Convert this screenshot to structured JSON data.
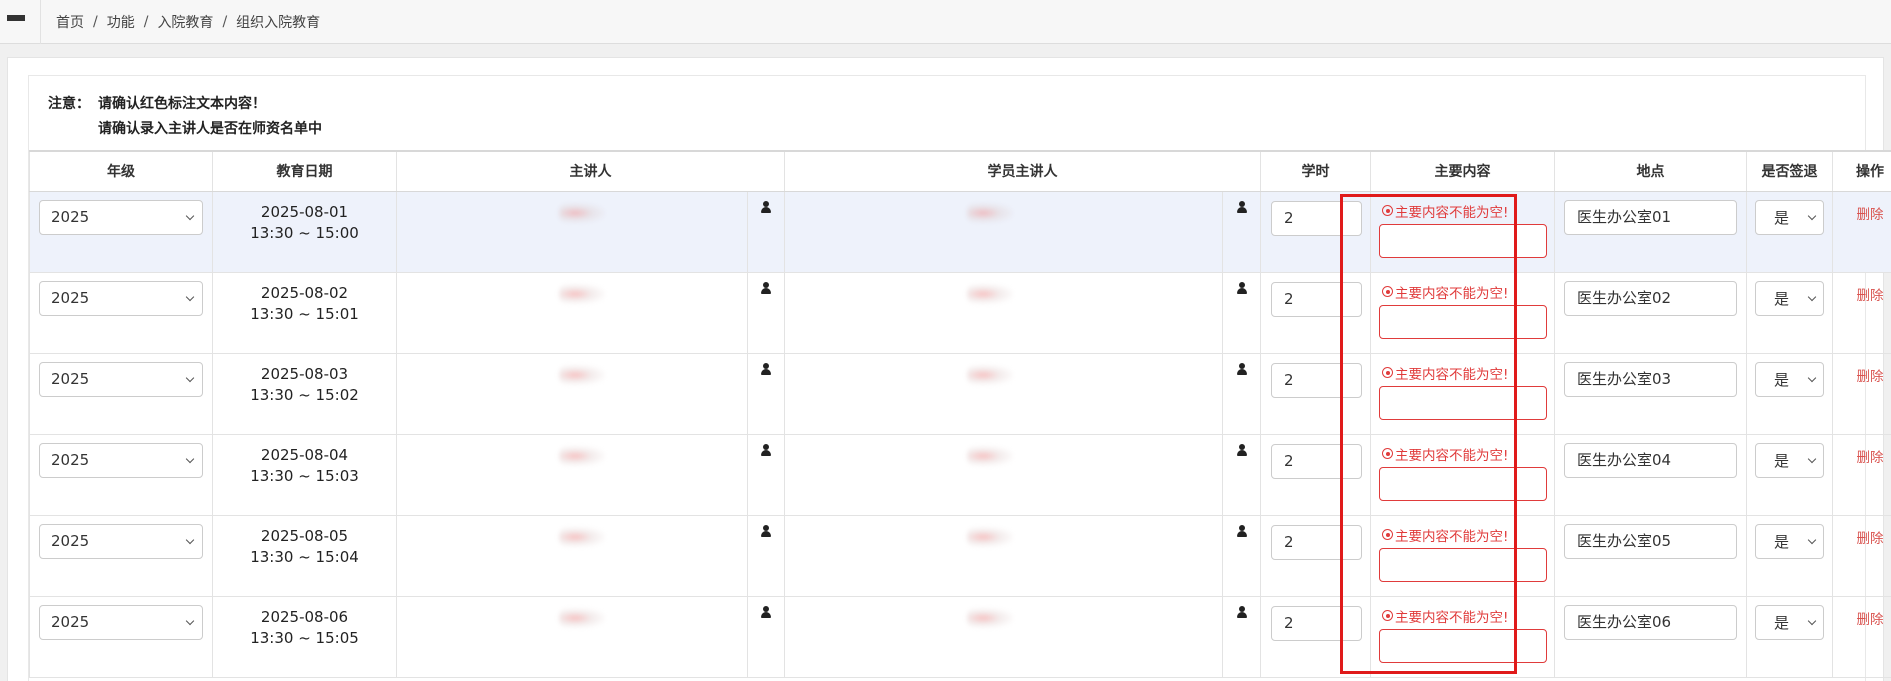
{
  "breadcrumb": [
    {
      "label": "首页"
    },
    {
      "label": "功能"
    },
    {
      "label": "入院教育"
    },
    {
      "label": "组织入院教育"
    }
  ],
  "breadcrumb_separator": "/",
  "notice": {
    "label": "注意：",
    "line1": "请确认红色标注文本内容！",
    "line2": "请确认录入主讲人是否在师资名单中"
  },
  "table": {
    "headers": {
      "grade": "年级",
      "date": "教育日期",
      "lecturer": "主讲人",
      "student_lecturer": "学员主讲人",
      "hours": "学时",
      "content": "主要内容",
      "place": "地点",
      "signout": "是否签退",
      "action": "操作"
    },
    "rows": [
      {
        "grade": "2025",
        "date": "2025-08-01",
        "time": "13:30 ~ 15:00",
        "hours": "2",
        "content_error": "主要内容不能为空!",
        "place": "医生办公室01",
        "signout": "是",
        "action": "删除"
      },
      {
        "grade": "2025",
        "date": "2025-08-02",
        "time": "13:30 ~ 15:01",
        "hours": "2",
        "content_error": "主要内容不能为空!",
        "place": "医生办公室02",
        "signout": "是",
        "action": "删除"
      },
      {
        "grade": "2025",
        "date": "2025-08-03",
        "time": "13:30 ~ 15:02",
        "hours": "2",
        "content_error": "主要内容不能为空!",
        "place": "医生办公室03",
        "signout": "是",
        "action": "删除"
      },
      {
        "grade": "2025",
        "date": "2025-08-04",
        "time": "13:30 ~ 15:03",
        "hours": "2",
        "content_error": "主要内容不能为空!",
        "place": "医生办公室04",
        "signout": "是",
        "action": "删除"
      },
      {
        "grade": "2025",
        "date": "2025-08-05",
        "time": "13:30 ~ 15:04",
        "hours": "2",
        "content_error": "主要内容不能为空!",
        "place": "医生办公室05",
        "signout": "是",
        "action": "删除"
      },
      {
        "grade": "2025",
        "date": "2025-08-06",
        "time": "13:30 ~ 15:05",
        "hours": "2",
        "content_error": "主要内容不能为空!",
        "place": "医生办公室06",
        "signout": "是",
        "action": "删除"
      }
    ]
  },
  "colors": {
    "error": "#e03b3b",
    "highlight_box": "#e01a1a",
    "delete_link": "#d9534f",
    "row_highlight": "#eef2fb"
  },
  "icons": [
    "menu-icon",
    "user-icon",
    "error-circle-icon",
    "chevron-down-icon"
  ]
}
